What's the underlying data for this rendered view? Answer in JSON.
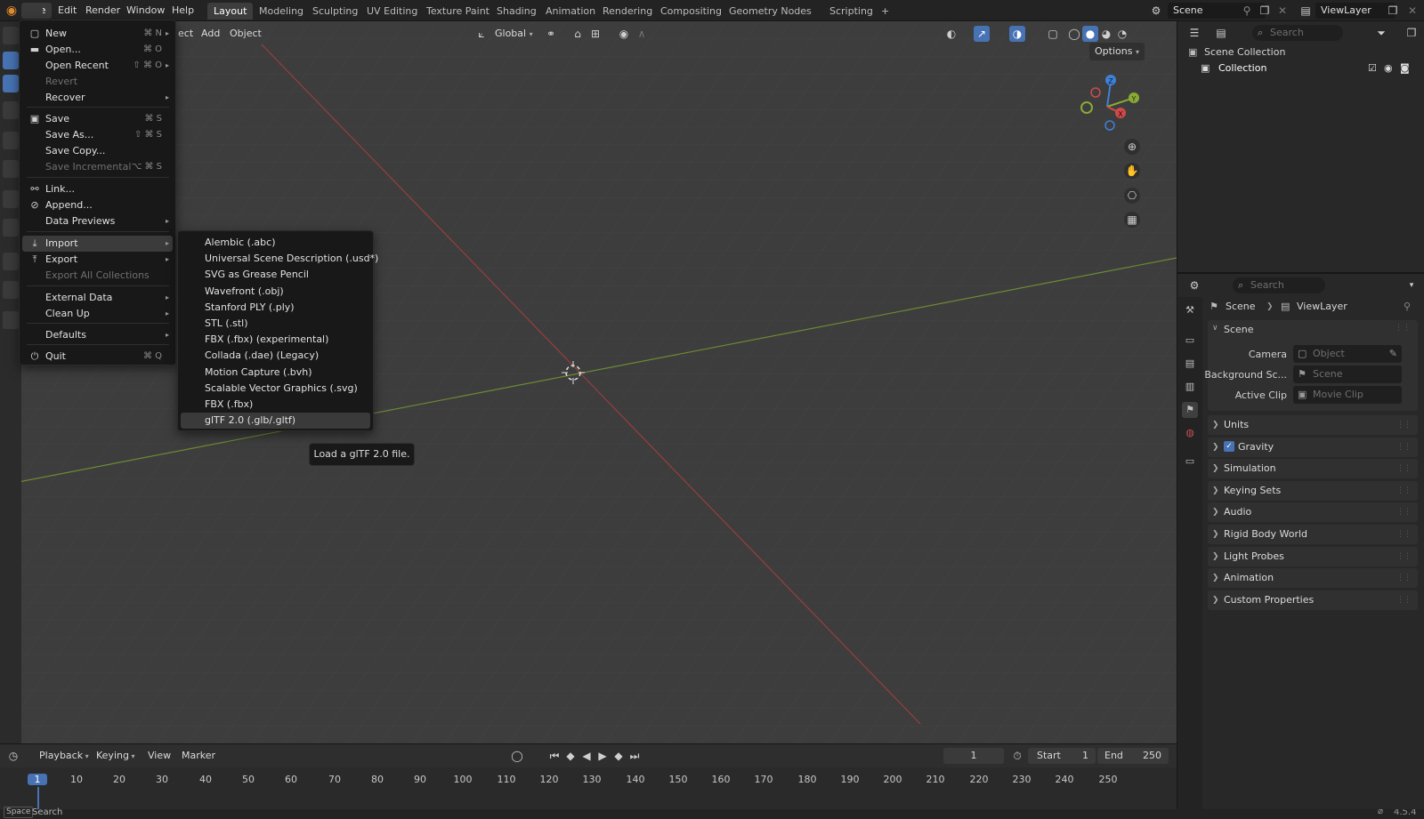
{
  "topbar": {
    "menus": [
      "File",
      "Edit",
      "Render",
      "Window",
      "Help"
    ],
    "workspaces": [
      "Layout",
      "Modeling",
      "Sculpting",
      "UV Editing",
      "Texture Paint",
      "Shading",
      "Animation",
      "Rendering",
      "Compositing",
      "Geometry Nodes",
      "Scripting"
    ],
    "add_tab": "+",
    "scene": "Scene",
    "view_layer": "ViewLayer"
  },
  "viewport": {
    "menus": [
      "ect",
      "Add",
      "Object"
    ],
    "orientation": "Global",
    "options": "Options",
    "gizmo": {
      "z": "Z",
      "y": "Y",
      "x": "X"
    }
  },
  "file_menu": {
    "items": [
      {
        "label": "New",
        "shortcut": "⌘ N",
        "icon": "new-file-icon",
        "glyph": "▢",
        "arrow": true
      },
      {
        "label": "Open...",
        "shortcut": "⌘ O",
        "icon": "folder-icon",
        "glyph": "▬"
      },
      {
        "label": "Open Recent",
        "shortcut": "⇧ ⌘ O",
        "arrow": true
      },
      {
        "label": "Revert",
        "disabled": true
      },
      {
        "label": "Recover",
        "arrow": true
      },
      {
        "label": "Save",
        "shortcut": "⌘ S",
        "icon": "save-icon",
        "glyph": "▣"
      },
      {
        "label": "Save As...",
        "shortcut": "⇧ ⌘ S"
      },
      {
        "label": "Save Copy..."
      },
      {
        "label": "Save Incremental",
        "shortcut": "⌥ ⌘ S",
        "disabled": true
      },
      {
        "label": "Link...",
        "icon": "link-icon",
        "glyph": "⚯"
      },
      {
        "label": "Append...",
        "icon": "append-icon",
        "glyph": "⊘"
      },
      {
        "label": "Data Previews",
        "arrow": true
      },
      {
        "label": "Import",
        "icon": "import-icon",
        "glyph": "⤓",
        "arrow": true
      },
      {
        "label": "Export",
        "icon": "export-icon",
        "glyph": "⤒",
        "arrow": true
      },
      {
        "label": "Export All Collections",
        "disabled": true
      },
      {
        "label": "External Data",
        "arrow": true
      },
      {
        "label": "Clean Up",
        "arrow": true
      },
      {
        "label": "Defaults",
        "arrow": true
      },
      {
        "label": "Quit",
        "shortcut": "⌘ Q",
        "icon": "power-icon",
        "glyph": "⏻"
      }
    ]
  },
  "import_menu": {
    "items": [
      "Alembic (.abc)",
      "Universal Scene Description (.usd*)",
      "SVG as Grease Pencil",
      "Wavefront (.obj)",
      "Stanford PLY (.ply)",
      "STL (.stl)",
      "FBX (.fbx) (experimental)",
      "Collada (.dae) (Legacy)",
      "Motion Capture (.bvh)",
      "Scalable Vector Graphics (.svg)",
      "FBX (.fbx)",
      "glTF 2.0 (.glb/.gltf)"
    ]
  },
  "tooltip": "Load a glTF 2.0 file.",
  "outliner": {
    "search_placeholder": "Search",
    "scene_collection": "Scene Collection",
    "collection": "Collection"
  },
  "properties": {
    "search_placeholder": "Search",
    "breadcrumb": [
      "Scene",
      "ViewLayer"
    ],
    "scene_panel": "Scene",
    "camera_label": "Camera",
    "camera_value": "Object",
    "background_label": "Background Sc...",
    "background_value": "Scene",
    "active_clip_label": "Active Clip",
    "active_clip_value": "Movie Clip",
    "panels": [
      "Units",
      "Gravity",
      "Simulation",
      "Keying Sets",
      "Audio",
      "Rigid Body World",
      "Light Probes",
      "Animation",
      "Custom Properties"
    ]
  },
  "timeline": {
    "menus": [
      "Playback",
      "Keying",
      "View",
      "Marker"
    ],
    "current_frame": "1",
    "start_label": "Start",
    "start_value": "1",
    "end_label": "End",
    "end_value": "250",
    "frames": [
      "1",
      "10",
      "20",
      "30",
      "40",
      "50",
      "60",
      "70",
      "80",
      "90",
      "100",
      "110",
      "120",
      "130",
      "140",
      "150",
      "160",
      "170",
      "180",
      "190",
      "200",
      "210",
      "220",
      "230",
      "240",
      "250"
    ]
  },
  "statusbar": {
    "key": "Space",
    "action": "Search",
    "version": "4.5.4"
  },
  "colors": {
    "x_axis": "#d04a4a",
    "y_axis": "#8aaa36",
    "z_axis": "#3f80d8",
    "accent": "#4772b3",
    "current_frame": "#4772b3"
  }
}
